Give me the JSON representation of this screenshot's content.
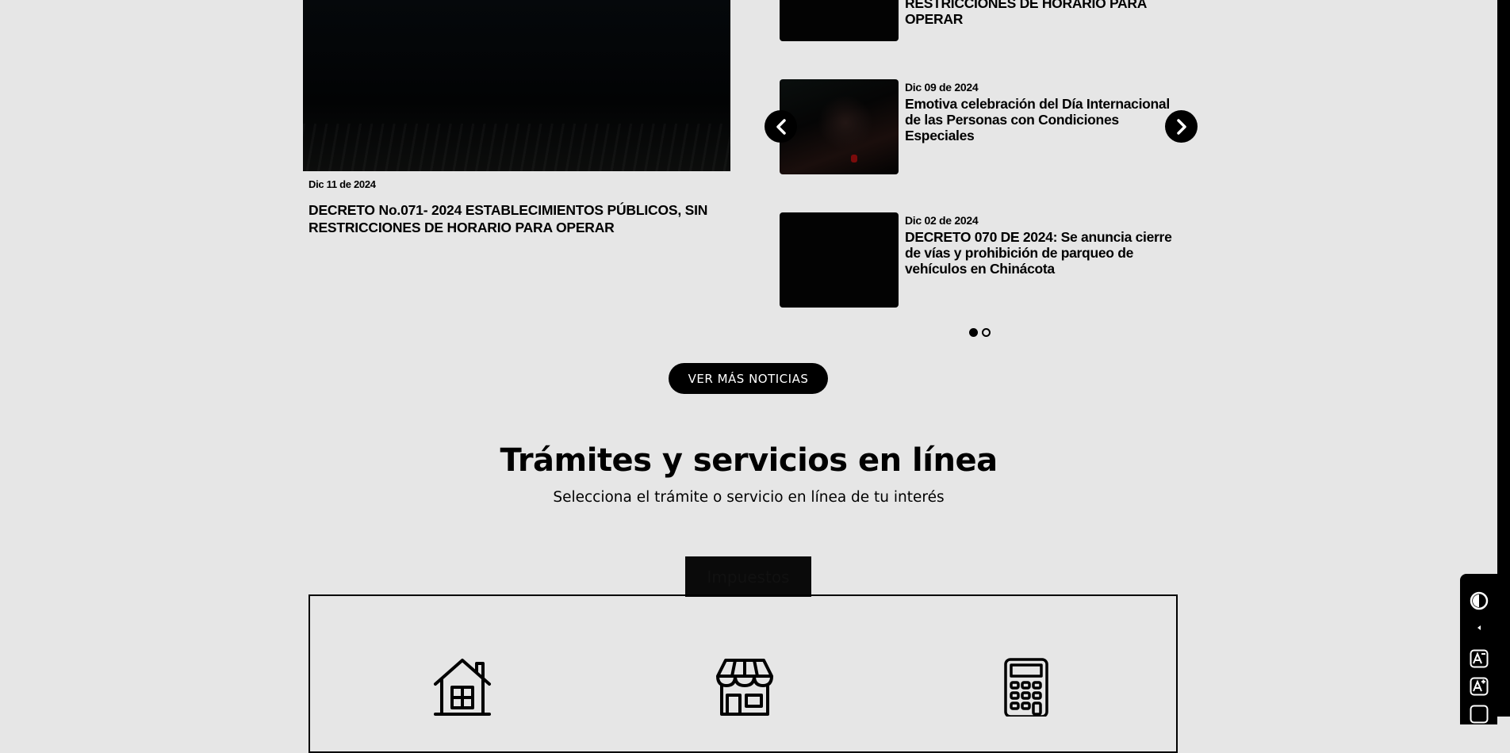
{
  "featured": {
    "date": "Dic 11 de 2024",
    "title": "DECRETO No.071- 2024 ESTABLECIMIENTOS PÚBLICOS, SIN RESTRICCIONES DE HORARIO PARA OPERAR"
  },
  "news_list": [
    {
      "date": "",
      "title": "RESTRICCIONES DE HORARIO PARA OPERAR"
    },
    {
      "date": "Dic 09 de 2024",
      "title": "Emotiva celebración del Día Internacional de las Personas con Condiciones Especiales"
    },
    {
      "date": "Dic 02 de 2024",
      "title": "DECRETO 070 DE 2024: Se anuncia cierre de vías y prohibición de parqueo de vehículos en Chinácota"
    }
  ],
  "carousel": {
    "pages": 2,
    "active_page": 1
  },
  "more_news_label": "VER MÁS NOTICIAS",
  "services": {
    "title": "Trámites y servicios en línea",
    "subtitle": "Selecciona el trámite o servicio en línea de tu interés",
    "active_tab": "Impuestos",
    "icons": [
      "house-icon",
      "store-icon",
      "calculator-icon"
    ]
  },
  "accessibility": {
    "icons": [
      "contrast-icon",
      "collapse-arrow-icon",
      "decrease-font-icon",
      "increase-font-icon",
      "accessibility-more-icon"
    ]
  }
}
